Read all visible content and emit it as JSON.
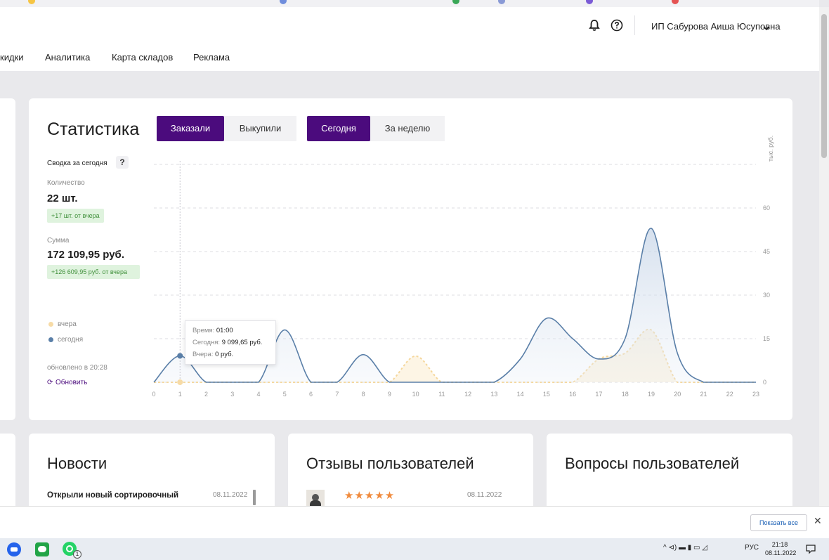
{
  "header": {
    "user_name": "ИП Сабурова Аиша Юсуповна",
    "nav": [
      "кидки",
      "Аналитика",
      "Карта складов",
      "Реклама"
    ],
    "icons": [
      "bell-icon",
      "help-icon",
      "chevron-down-icon"
    ]
  },
  "statistics": {
    "title": "Статистика",
    "tabs_type": [
      "Заказали",
      "Выкупили"
    ],
    "tabs_period": [
      "Сегодня",
      "За неделю"
    ],
    "summary_label": "Сводка за сегодня",
    "help": "?",
    "quantity_label": "Количество",
    "quantity_value": "22 шт.",
    "quantity_delta": "+17 шт. от вчера",
    "sum_label": "Сумма",
    "sum_value": "172 109,95 руб.",
    "sum_delta": "+126 609,95 руб. от вчера",
    "legend_yesterday": "вчера",
    "legend_today": "сегодня",
    "updated": "обновлено в 20:28",
    "refresh": "Обновить",
    "colors": {
      "accent": "#4b0b7d",
      "today": "#5a7fa8",
      "yesterday": "#f7dba6"
    }
  },
  "tooltip": {
    "time_label": "Время:",
    "time_value": "01:00",
    "today_label": "Сегодня:",
    "today_value": "9 099,65 руб.",
    "yesterday_label": "Вчера:",
    "yesterday_value": "0 руб."
  },
  "chart_data": {
    "type": "area",
    "ylabel": "тыс. руб.",
    "x": [
      0,
      1,
      2,
      3,
      4,
      5,
      6,
      7,
      8,
      9,
      10,
      11,
      12,
      13,
      14,
      15,
      16,
      17,
      18,
      19,
      20,
      21,
      22,
      23
    ],
    "ylim": [
      0,
      60
    ],
    "yticks": [
      0,
      15,
      30,
      45,
      60
    ],
    "series": [
      {
        "name": "сегодня",
        "values": [
          0,
          9.1,
          0,
          0,
          0,
          18,
          0,
          0,
          9.5,
          0,
          0,
          0,
          0,
          0,
          8,
          22,
          15,
          8,
          15,
          53,
          10,
          0,
          0,
          0
        ]
      },
      {
        "name": "вчера",
        "values": [
          0,
          0,
          0,
          0,
          0,
          0,
          0,
          0,
          0,
          0,
          9,
          0,
          0,
          0,
          0,
          0,
          0,
          8,
          10,
          18,
          0,
          0,
          0,
          0
        ]
      }
    ]
  },
  "news": {
    "title": "Новости",
    "item_title": "Открыли новый сортировочный",
    "item_date": "08.11.2022"
  },
  "reviews": {
    "title": "Отзывы пользователей",
    "stars": "★★★★★",
    "date": "08.11.2022"
  },
  "questions": {
    "title": "Вопросы пользователей"
  },
  "download_bar": {
    "show_all": "Показать все",
    "close": "✕"
  },
  "taskbar": {
    "chat_badge": "1",
    "lang": "РУС",
    "time": "21:18",
    "date": "08.11.2022",
    "tray_icons": "^ ⊲) ▬ ▮ ▭ ◿"
  }
}
